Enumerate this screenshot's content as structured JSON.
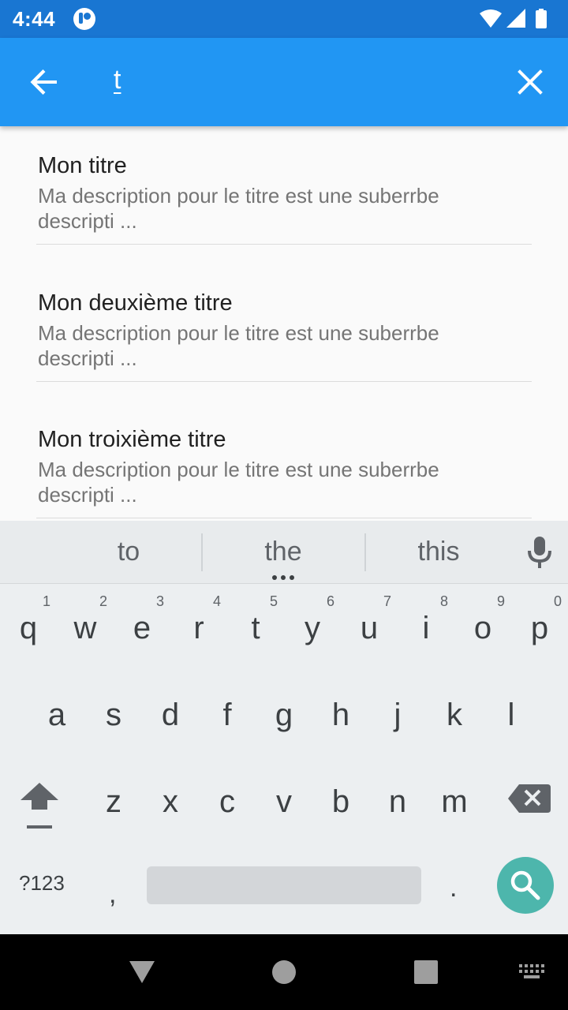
{
  "status_bar": {
    "time": "4:44"
  },
  "app_bar": {
    "search_query": "t"
  },
  "results": [
    {
      "title": "Mon titre",
      "description": "Ma description pour le titre est une suberrbe descripti ..."
    },
    {
      "title": "Mon deuxième titre",
      "description": "Ma description pour le titre est une suberrbe descripti ..."
    },
    {
      "title": "Mon troixième titre",
      "description": "Ma description pour le titre est une suberrbe descripti ..."
    }
  ],
  "keyboard": {
    "suggestions": [
      "to",
      "the",
      "this"
    ],
    "row1": [
      {
        "key": "q",
        "num": "1"
      },
      {
        "key": "w",
        "num": "2"
      },
      {
        "key": "e",
        "num": "3"
      },
      {
        "key": "r",
        "num": "4"
      },
      {
        "key": "t",
        "num": "5"
      },
      {
        "key": "y",
        "num": "6"
      },
      {
        "key": "u",
        "num": "7"
      },
      {
        "key": "i",
        "num": "8"
      },
      {
        "key": "o",
        "num": "9"
      },
      {
        "key": "p",
        "num": "0"
      }
    ],
    "row2": [
      "a",
      "s",
      "d",
      "f",
      "g",
      "h",
      "j",
      "k",
      "l"
    ],
    "row3": [
      "z",
      "x",
      "c",
      "v",
      "b",
      "n",
      "m"
    ],
    "symbols_label": "?123",
    "comma": ",",
    "period": "."
  },
  "colors": {
    "status_bar": "#1976d2",
    "app_bar": "#2196f3",
    "search_fab": "#4db6ac",
    "keyboard_bg": "#eceff1"
  },
  "icons": [
    "back-arrow-icon",
    "close-icon",
    "wifi-icon",
    "signal-icon",
    "battery-icon",
    "mic-icon",
    "shift-icon",
    "backspace-icon",
    "search-icon",
    "nav-back-icon",
    "nav-home-icon",
    "nav-recents-icon",
    "keyboard-switch-icon"
  ]
}
